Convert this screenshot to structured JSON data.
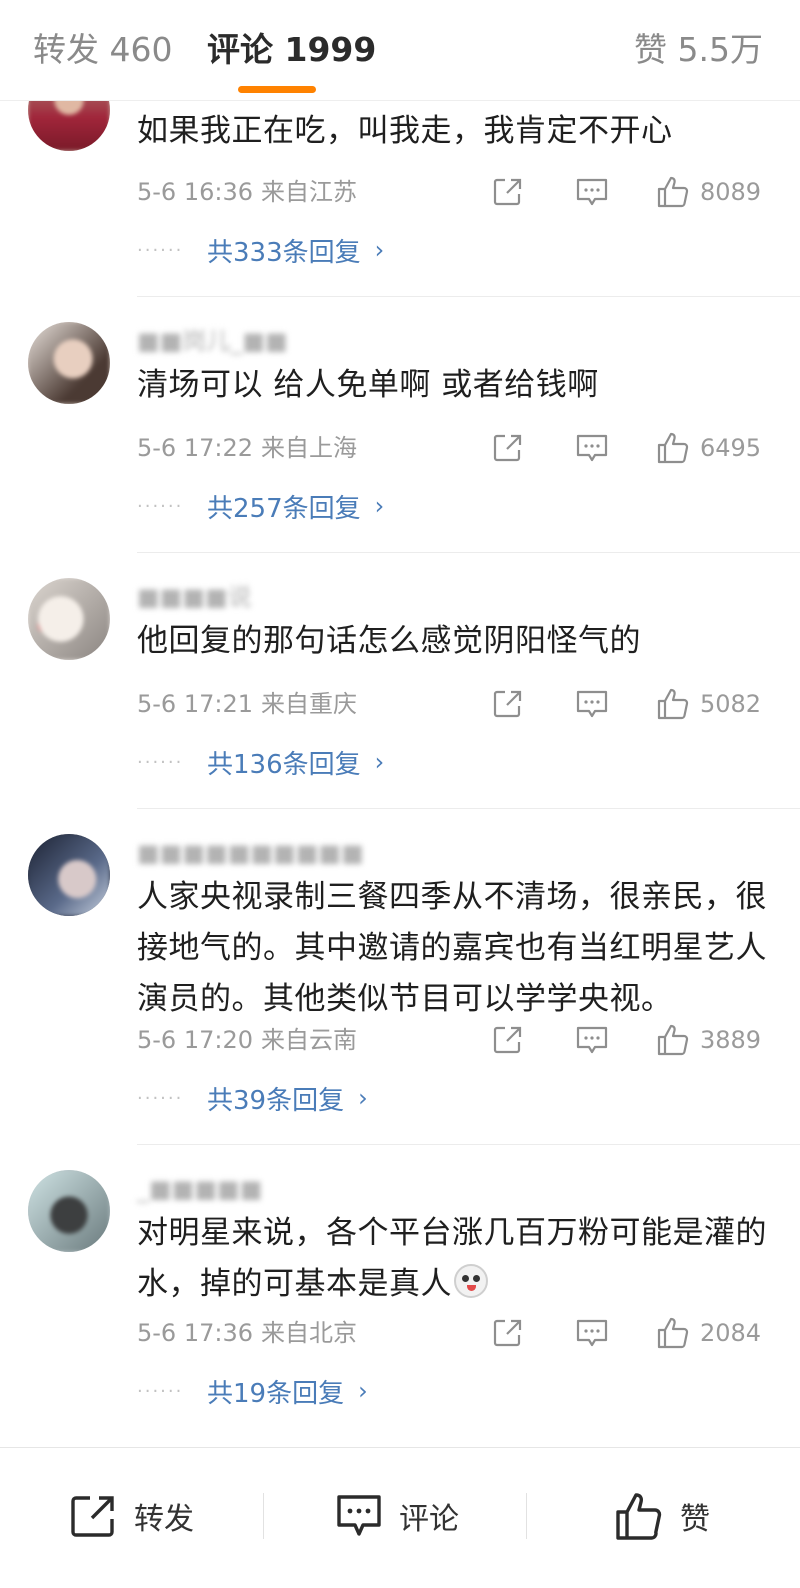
{
  "tabs": {
    "repost": "转发 460",
    "comment": "评论 1999",
    "like": "赞 5.5万"
  },
  "comments": [
    {
      "username": "",
      "text": "如果我正在吃，叫我走，我肯定不开心",
      "time": "5-6 16:36",
      "location": "来自江苏",
      "likes": "8089",
      "replies": "共333条回复"
    },
    {
      "username": "■■岗儿_■■",
      "text": "清场可以 给人免单啊 或者给钱啊",
      "time": "5-6 17:22",
      "location": "来自上海",
      "likes": "6495",
      "replies": "共257条回复"
    },
    {
      "username": "■■■■说",
      "text": "他回复的那句话怎么感觉阴阳怪气的",
      "time": "5-6 17:21",
      "location": "来自重庆",
      "likes": "5082",
      "replies": "共136条回复"
    },
    {
      "username": "■■■■■■■■■■",
      "text": "人家央视录制三餐四季从不清场，很亲民，很接地气的。其中邀请的嘉宾也有当红明星艺人演员的。其他类似节目可以学学央视。",
      "time": "5-6 17:20",
      "location": "来自云南",
      "likes": "3889",
      "replies": "共39条回复"
    },
    {
      "username": "_■■■■■",
      "text": "对明星来说，各个平台涨几百万粉可能是灌的水，掉的可基本是真人",
      "time": "5-6 17:36",
      "location": "来自北京",
      "likes": "2084",
      "replies": "共19条回复"
    }
  ],
  "bottom_bar": {
    "repost": "转发",
    "comment": "评论",
    "like": "赞"
  },
  "colors": {
    "accent": "#ff8200",
    "link": "#4a7cb8",
    "muted": "#9a9a9a"
  }
}
